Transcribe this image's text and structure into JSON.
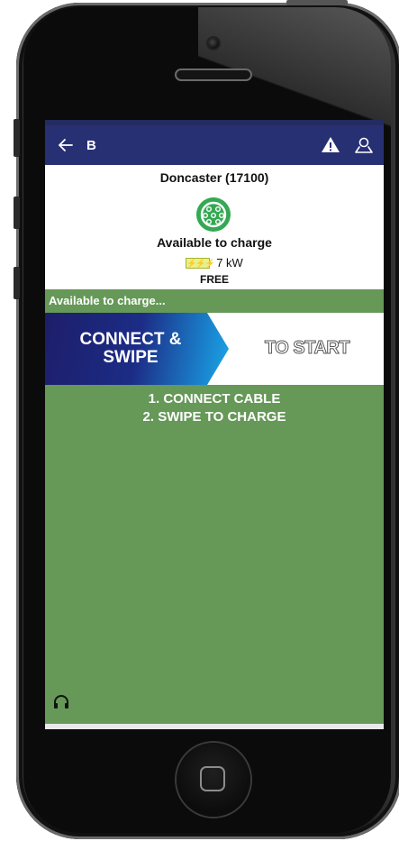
{
  "app_bar": {
    "title": "B",
    "back_icon": "arrow-left-icon",
    "warning_icon": "warning-icon",
    "account_icon": "account-icon"
  },
  "station": {
    "name": "Doncaster (17100)",
    "connector_icon": "type2-connector-icon",
    "status": "Available to charge",
    "power": "7 kW",
    "price": "FREE"
  },
  "status_bar": {
    "text": "Available to charge..."
  },
  "banner": {
    "line1": "CONNECT &",
    "line2": "SWIPE",
    "right_text": "TO START"
  },
  "instructions": {
    "step1": "1. CONNECT CABLE",
    "step2": "2. SWIPE TO CHARGE"
  },
  "support": {
    "icon": "headset-icon"
  },
  "colors": {
    "app_bar": "#283074",
    "green": "#669858",
    "connector": "#34a853"
  }
}
